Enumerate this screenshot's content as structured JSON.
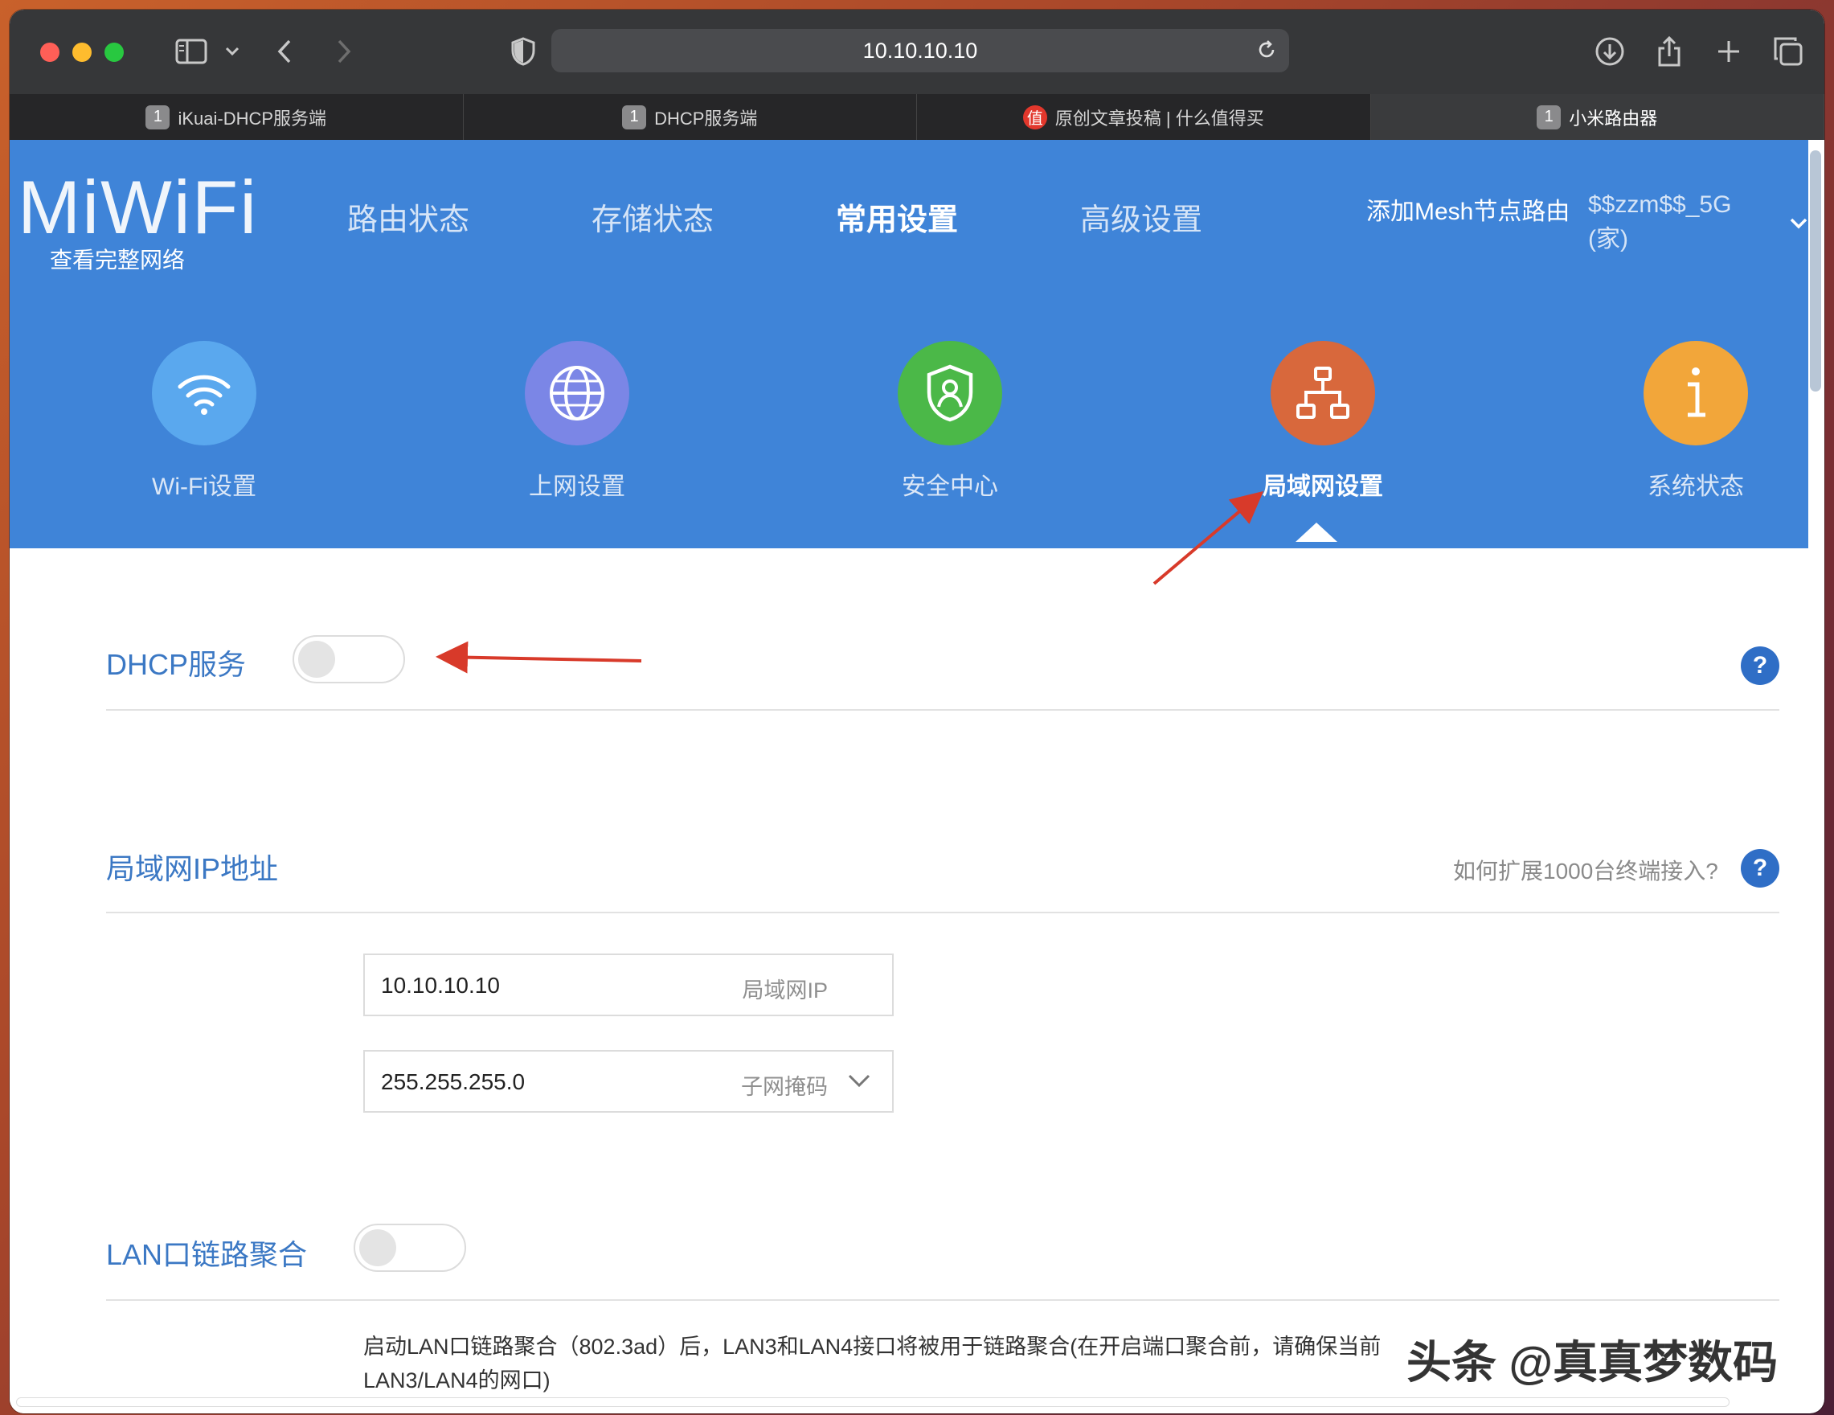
{
  "browser": {
    "url": "10.10.10.10",
    "tabs": [
      {
        "badge": "1",
        "title": "iKuai-DHCP服务端"
      },
      {
        "badge": "1",
        "title": "DHCP服务端"
      },
      {
        "badge": "值",
        "title": "原创文章投稿 | 什么值得买"
      },
      {
        "badge": "1",
        "title": "小米路由器"
      }
    ]
  },
  "header": {
    "logo": "MiWiFi",
    "logo_sub": "查看完整网络",
    "nav": [
      "路由状态",
      "存储状态",
      "常用设置",
      "高级设置"
    ],
    "mesh_link": "添加Mesh节点路由",
    "ssid": "$$zzm$$_5G (家)"
  },
  "features": [
    {
      "label": "Wi-Fi设置",
      "icon": "wifi-icon",
      "color": "#5aa8ee"
    },
    {
      "label": "上网设置",
      "icon": "globe-icon",
      "color": "#7b86e6"
    },
    {
      "label": "安全中心",
      "icon": "shield-icon",
      "color": "#4bb848"
    },
    {
      "label": "局域网设置",
      "icon": "lan-network-icon",
      "color": "#d8683c"
    },
    {
      "label": "系统状态",
      "icon": "info-icon",
      "color": "#f2a63a"
    }
  ],
  "dhcp": {
    "title": "DHCP服务",
    "enabled": false
  },
  "lan_ip": {
    "title": "局域网IP地址",
    "help_text": "如何扩展1000台终端接入?",
    "ip_value": "10.10.10.10",
    "ip_label": "局域网IP",
    "mask_value": "255.255.255.0",
    "mask_label": "子网掩码"
  },
  "lag": {
    "title": "LAN口链路聚合",
    "enabled": false,
    "desc_line1": "启动LAN口链路聚合（802.3ad）后，LAN3和LAN4接口将被用于链路聚合(在开启端口聚合前，请确保当前",
    "desc_line2": "LAN3/LAN4的网口)"
  },
  "watermark": "头条 @真真梦数码",
  "help_glyph": "?",
  "colors": {
    "header": "#3f84d8",
    "accent_text": "#3b78c4",
    "annotation_arrow": "#d83a2a"
  }
}
